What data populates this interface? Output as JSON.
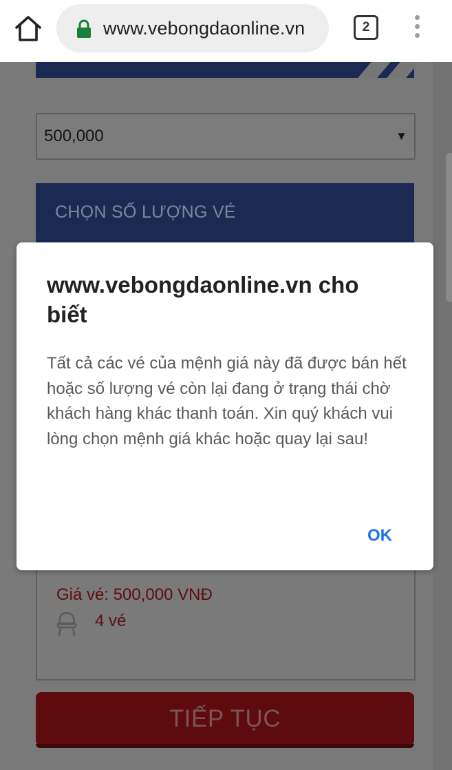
{
  "browser": {
    "url": "www.vebongdaonline.vn",
    "tab_count": "2",
    "icons": {
      "home": "home-icon",
      "lock": "lock-icon",
      "tabs": "tab-switcher-icon",
      "menu": "more-vert-icon"
    }
  },
  "page": {
    "price_select": {
      "selected_value": "500,000",
      "arrow": "▼"
    },
    "quantity_section": {
      "header_label": "CHỌN SỐ LƯỢNG VÉ"
    },
    "summary": {
      "ticket_price": "Giá vé: 500,000 VNĐ",
      "ticket_count": "4 vé",
      "seat_icon": "seat-icon"
    },
    "continue_button": {
      "label": "TIẾP TỤC"
    }
  },
  "dialog": {
    "title": "www.vebongdaonline.vn cho biết",
    "message": "Tất cả các vé của mệnh giá này đã được bán hết hoặc số lượng vé còn lại đang ở trạng thái chờ khách hàng khác thanh toán. Xin quý khách vui lòng chọn mệnh giá khác hoặc quay lại sau!",
    "ok_label": "OK"
  },
  "colors": {
    "dialog_button": "#1a73e8",
    "lock_green": "#188038",
    "banner_blue": "#1a2a52",
    "continue_red": "#b01c22",
    "price_text_red": "#b71c1c"
  }
}
